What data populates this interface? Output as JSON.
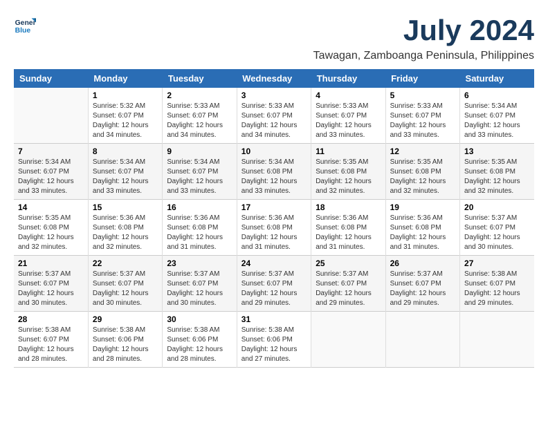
{
  "header": {
    "logo_line1": "General",
    "logo_line2": "Blue",
    "month": "July 2024",
    "location": "Tawagan, Zamboanga Peninsula, Philippines"
  },
  "weekdays": [
    "Sunday",
    "Monday",
    "Tuesday",
    "Wednesday",
    "Thursday",
    "Friday",
    "Saturday"
  ],
  "weeks": [
    [
      {
        "day": "",
        "sunrise": "",
        "sunset": "",
        "daylight": ""
      },
      {
        "day": "1",
        "sunrise": "Sunrise: 5:32 AM",
        "sunset": "Sunset: 6:07 PM",
        "daylight": "Daylight: 12 hours and 34 minutes."
      },
      {
        "day": "2",
        "sunrise": "Sunrise: 5:33 AM",
        "sunset": "Sunset: 6:07 PM",
        "daylight": "Daylight: 12 hours and 34 minutes."
      },
      {
        "day": "3",
        "sunrise": "Sunrise: 5:33 AM",
        "sunset": "Sunset: 6:07 PM",
        "daylight": "Daylight: 12 hours and 34 minutes."
      },
      {
        "day": "4",
        "sunrise": "Sunrise: 5:33 AM",
        "sunset": "Sunset: 6:07 PM",
        "daylight": "Daylight: 12 hours and 33 minutes."
      },
      {
        "day": "5",
        "sunrise": "Sunrise: 5:33 AM",
        "sunset": "Sunset: 6:07 PM",
        "daylight": "Daylight: 12 hours and 33 minutes."
      },
      {
        "day": "6",
        "sunrise": "Sunrise: 5:34 AM",
        "sunset": "Sunset: 6:07 PM",
        "daylight": "Daylight: 12 hours and 33 minutes."
      }
    ],
    [
      {
        "day": "7",
        "sunrise": "Sunrise: 5:34 AM",
        "sunset": "Sunset: 6:07 PM",
        "daylight": "Daylight: 12 hours and 33 minutes."
      },
      {
        "day": "8",
        "sunrise": "Sunrise: 5:34 AM",
        "sunset": "Sunset: 6:07 PM",
        "daylight": "Daylight: 12 hours and 33 minutes."
      },
      {
        "day": "9",
        "sunrise": "Sunrise: 5:34 AM",
        "sunset": "Sunset: 6:07 PM",
        "daylight": "Daylight: 12 hours and 33 minutes."
      },
      {
        "day": "10",
        "sunrise": "Sunrise: 5:34 AM",
        "sunset": "Sunset: 6:08 PM",
        "daylight": "Daylight: 12 hours and 33 minutes."
      },
      {
        "day": "11",
        "sunrise": "Sunrise: 5:35 AM",
        "sunset": "Sunset: 6:08 PM",
        "daylight": "Daylight: 12 hours and 32 minutes."
      },
      {
        "day": "12",
        "sunrise": "Sunrise: 5:35 AM",
        "sunset": "Sunset: 6:08 PM",
        "daylight": "Daylight: 12 hours and 32 minutes."
      },
      {
        "day": "13",
        "sunrise": "Sunrise: 5:35 AM",
        "sunset": "Sunset: 6:08 PM",
        "daylight": "Daylight: 12 hours and 32 minutes."
      }
    ],
    [
      {
        "day": "14",
        "sunrise": "Sunrise: 5:35 AM",
        "sunset": "Sunset: 6:08 PM",
        "daylight": "Daylight: 12 hours and 32 minutes."
      },
      {
        "day": "15",
        "sunrise": "Sunrise: 5:36 AM",
        "sunset": "Sunset: 6:08 PM",
        "daylight": "Daylight: 12 hours and 32 minutes."
      },
      {
        "day": "16",
        "sunrise": "Sunrise: 5:36 AM",
        "sunset": "Sunset: 6:08 PM",
        "daylight": "Daylight: 12 hours and 31 minutes."
      },
      {
        "day": "17",
        "sunrise": "Sunrise: 5:36 AM",
        "sunset": "Sunset: 6:08 PM",
        "daylight": "Daylight: 12 hours and 31 minutes."
      },
      {
        "day": "18",
        "sunrise": "Sunrise: 5:36 AM",
        "sunset": "Sunset: 6:08 PM",
        "daylight": "Daylight: 12 hours and 31 minutes."
      },
      {
        "day": "19",
        "sunrise": "Sunrise: 5:36 AM",
        "sunset": "Sunset: 6:08 PM",
        "daylight": "Daylight: 12 hours and 31 minutes."
      },
      {
        "day": "20",
        "sunrise": "Sunrise: 5:37 AM",
        "sunset": "Sunset: 6:07 PM",
        "daylight": "Daylight: 12 hours and 30 minutes."
      }
    ],
    [
      {
        "day": "21",
        "sunrise": "Sunrise: 5:37 AM",
        "sunset": "Sunset: 6:07 PM",
        "daylight": "Daylight: 12 hours and 30 minutes."
      },
      {
        "day": "22",
        "sunrise": "Sunrise: 5:37 AM",
        "sunset": "Sunset: 6:07 PM",
        "daylight": "Daylight: 12 hours and 30 minutes."
      },
      {
        "day": "23",
        "sunrise": "Sunrise: 5:37 AM",
        "sunset": "Sunset: 6:07 PM",
        "daylight": "Daylight: 12 hours and 30 minutes."
      },
      {
        "day": "24",
        "sunrise": "Sunrise: 5:37 AM",
        "sunset": "Sunset: 6:07 PM",
        "daylight": "Daylight: 12 hours and 29 minutes."
      },
      {
        "day": "25",
        "sunrise": "Sunrise: 5:37 AM",
        "sunset": "Sunset: 6:07 PM",
        "daylight": "Daylight: 12 hours and 29 minutes."
      },
      {
        "day": "26",
        "sunrise": "Sunrise: 5:37 AM",
        "sunset": "Sunset: 6:07 PM",
        "daylight": "Daylight: 12 hours and 29 minutes."
      },
      {
        "day": "27",
        "sunrise": "Sunrise: 5:38 AM",
        "sunset": "Sunset: 6:07 PM",
        "daylight": "Daylight: 12 hours and 29 minutes."
      }
    ],
    [
      {
        "day": "28",
        "sunrise": "Sunrise: 5:38 AM",
        "sunset": "Sunset: 6:07 PM",
        "daylight": "Daylight: 12 hours and 28 minutes."
      },
      {
        "day": "29",
        "sunrise": "Sunrise: 5:38 AM",
        "sunset": "Sunset: 6:06 PM",
        "daylight": "Daylight: 12 hours and 28 minutes."
      },
      {
        "day": "30",
        "sunrise": "Sunrise: 5:38 AM",
        "sunset": "Sunset: 6:06 PM",
        "daylight": "Daylight: 12 hours and 28 minutes."
      },
      {
        "day": "31",
        "sunrise": "Sunrise: 5:38 AM",
        "sunset": "Sunset: 6:06 PM",
        "daylight": "Daylight: 12 hours and 27 minutes."
      },
      {
        "day": "",
        "sunrise": "",
        "sunset": "",
        "daylight": ""
      },
      {
        "day": "",
        "sunrise": "",
        "sunset": "",
        "daylight": ""
      },
      {
        "day": "",
        "sunrise": "",
        "sunset": "",
        "daylight": ""
      }
    ]
  ]
}
